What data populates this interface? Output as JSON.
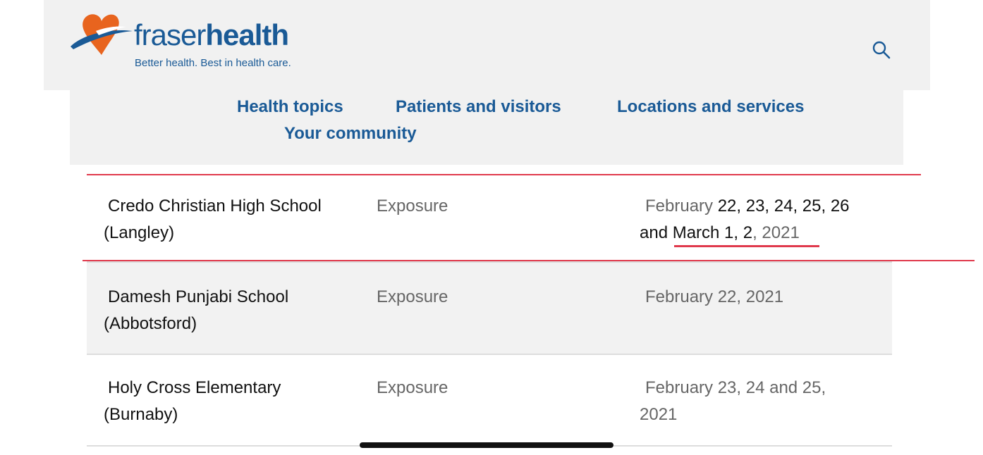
{
  "header": {
    "brand_light": "fraser",
    "brand_bold": "health",
    "tagline": "Better health. Best in health care."
  },
  "nav": {
    "items": [
      {
        "label": "Health topics"
      },
      {
        "label": "Patients and visitors"
      },
      {
        "label": "Locations and services"
      },
      {
        "label": "Your community"
      }
    ]
  },
  "rows": [
    {
      "school_line1": "Credo Christian High School",
      "school_line2": "(Langley)",
      "type": "Exposure",
      "date_line1_a": "February ",
      "date_line1_b": "22, 23, 24, 25, 26",
      "date_line2_a": "and March 1, 2",
      "date_line2_b": ", 2021"
    },
    {
      "school_line1": "Damesh Punjabi School",
      "school_line2": "(Abbotsford)",
      "type": "Exposure",
      "date_line1": "February 22, 2021"
    },
    {
      "school_line1": "Holy Cross Elementary",
      "school_line2": "(Burnaby)",
      "type": "Exposure",
      "date_line1": "February 23, 24 and 25,",
      "date_line2": "2021"
    }
  ],
  "icons": {
    "logo": "fraser-health-heart-logo-icon",
    "search": "search-icon"
  },
  "colors": {
    "brand_blue": "#1a5a96",
    "brand_orange": "#e8641e",
    "highlight_red": "#e0394c"
  }
}
